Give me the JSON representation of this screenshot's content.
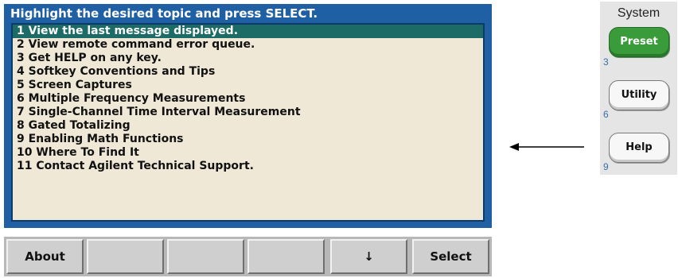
{
  "display": {
    "header": "Highlight the desired topic and press SELECT.",
    "items": [
      "1 View the last message displayed.",
      "2 View remote command error queue.",
      "3 Get HELP on any key.",
      "4 Softkey Conventions and Tips",
      "5 Screen Captures",
      "6 Multiple Frequency Measurements",
      "7 Single-Channel Time Interval Measurement",
      "8 Gated Totalizing",
      "9 Enabling Math Functions",
      "10 Where To Find It",
      "11 Contact Agilent Technical Support."
    ],
    "selected_index": 0
  },
  "softkeys": [
    "About",
    "",
    "",
    "",
    "↓",
    "Select"
  ],
  "panel": {
    "title": "System",
    "keys": [
      {
        "label": "Preset",
        "number": "3"
      },
      {
        "label": "Utility",
        "number": "6"
      },
      {
        "label": "Help",
        "number": "9"
      }
    ]
  },
  "colors": {
    "display_frame": "#1f5fa3",
    "list_background": "#efe8d6",
    "selection": "#1c6b66",
    "preset_key": "#3a9b3a",
    "key_number": "#3a6fa8"
  }
}
